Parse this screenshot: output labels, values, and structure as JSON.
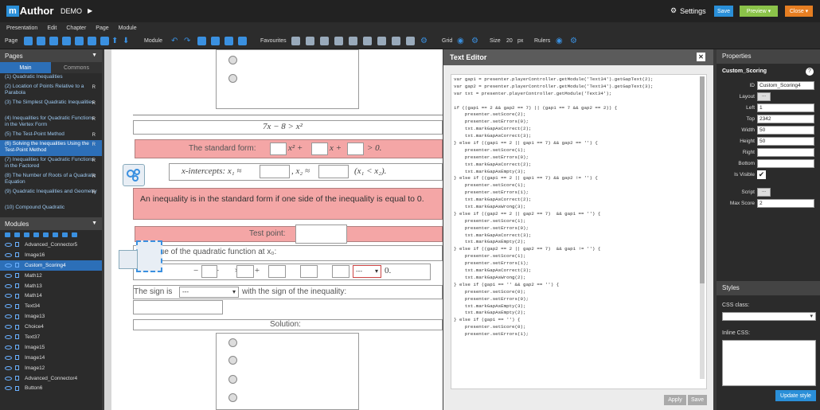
{
  "app": {
    "logo_m": "m",
    "logo_rest": "Author",
    "project": "DEMO",
    "settings": "Settings",
    "save": "Save",
    "preview": "Preview",
    "close": "Close"
  },
  "menu": [
    "Presentation",
    "Edit",
    "Chapter",
    "Page",
    "Module"
  ],
  "toolbar": {
    "page": "Page",
    "module": "Module",
    "favourites": "Favourites",
    "grid": "Grid",
    "size": "Size",
    "size_value": "20",
    "size_unit": "px",
    "rulers": "Rulers"
  },
  "pages": {
    "title": "Pages",
    "tab_main": "Main",
    "tab_commons": "Commons",
    "items": [
      {
        "label": "(1) Quadratic Inequalities",
        "r": ""
      },
      {
        "label": "(2) Location of Points Relative to a Parabola",
        "r": "R"
      },
      {
        "label": "(3) The Simplest Quadratic Inequalities",
        "r": "R"
      },
      {
        "label": "(4) Inequalities for Quadratic Functions in the Vertex Form",
        "r": "R"
      },
      {
        "label": "(5) The Test-Point Method",
        "r": "R"
      },
      {
        "label": "(6) Solving the Inequalities Using the Test-Point Method",
        "r": "R"
      },
      {
        "label": "(7) Inequalities for Quadratic Functions in the Factored",
        "r": "R"
      },
      {
        "label": "(8) The Number of Roots of a Quadratic Equation",
        "r": "R"
      },
      {
        "label": "(9) Quadratic Inequalities and Geometry",
        "r": "R"
      },
      {
        "label": "(10) Compound Quadratic",
        "r": ""
      }
    ]
  },
  "modules": {
    "title": "Modules",
    "items": [
      "Advanced_Connector5",
      "Image16",
      "Custom_Scoring4",
      "Math12",
      "Math13",
      "Math14",
      "Text34",
      "Image13",
      "Choice4",
      "Text37",
      "Image15",
      "Image14",
      "Image12",
      "Advanced_Connector4",
      "Button6"
    ]
  },
  "canvas": {
    "eq1": "7x − 8 > x²",
    "std_form": "The standard form:",
    "std_gt": "> 0.",
    "x_ints": "x-intercepts: x₁ ≈",
    "x_ints2": ", x₂ ≈",
    "x_ints3": "(x₁ < x₂).",
    "note": "An inequality is in the standard form if one side of the inequality is equal to 0.",
    "test_point": "Test point:",
    "value_of": "value of the quadratic function at x₀:",
    "select_val": "---",
    "sign_pre": "The sign is",
    "sign_post": "with the sign of the inequality:",
    "solution": "Solution:",
    "dot": "0."
  },
  "editor": {
    "title": "Text Editor",
    "apply": "Apply",
    "save": "Save",
    "code": [
      "var gap1 = presenter.playerController.getModule('Text34').getGapText(2);",
      "var gap2 = presenter.playerController.getModule('Text34').getGapText(3);",
      "var txt = presenter.playerController.getModule('Text34');",
      "",
      "if ((gap1 == 2 && gap2 == 7) || (gap1 == 7 && gap2 == 2)) {",
      "    presenter.setScore(2);",
      "    presenter.setErrors(0);",
      "    txt.markGapAsCorrect(2);",
      "    txt.markGapAsCorrect(3);",
      "} else if ((gap1 == 2 || gap1 == 7) && gap2 == '') {",
      "    presenter.setScore(1);",
      "    presenter.setErrors(0);",
      "    txt.markGapAsCorrect(2);",
      "    txt.markGapAsEmpty(3);",
      "} else if ((gap1 == 2 || gap1 == 7) && gap2 != '') {",
      "    presenter.setScore(1);",
      "    presenter.setErrors(1);",
      "    txt.markGapAsCorrect(2);",
      "    txt.markGapAsWrong(3);",
      "} else if ((gap2 == 2 || gap2 == 7)  && gap1 == '') {",
      "    presenter.setScore(1);",
      "    presenter.setErrors(0);",
      "    txt.markGapAsCorrect(3);",
      "    txt.markGapAsEmpty(2);",
      "} else if ((gap2 == 2 || gap2 == 7)  && gap1 != '') {",
      "    presenter.setScore(1);",
      "    presenter.setErrors(1);",
      "    txt.markGapAsCorrect(3);",
      "    txt.markGapAsWrong(2);",
      "} else if (gap1 == '' && gap2 == '') {",
      "    presenter.setScore(0);",
      "    presenter.setErrors(0);",
      "    txt.markGapAsEmpty(3);",
      "    txt.markGapAsEmpty(2);",
      "} else if (gap1 == '') {",
      "    presenter.setScore(0);",
      "    presenter.setErrors(1);"
    ]
  },
  "properties": {
    "title": "Properties",
    "module": "Custom_Scoring",
    "id_label": "ID",
    "id": "Custom_Scoring4",
    "layout": "Layout",
    "left": "Left",
    "left_v": "1",
    "top": "Top",
    "top_v": "2342",
    "width": "Width",
    "width_v": "50",
    "height": "Height",
    "height_v": "50",
    "right": "Right",
    "bottom": "Bottom",
    "visible": "Is Visible",
    "script": "Script",
    "max_score": "Max Score",
    "max_score_v": "2",
    "dots": "..."
  },
  "styles": {
    "title": "Styles",
    "css_class": "CSS class:",
    "inline_css": "Inline CSS:",
    "update": "Update style"
  },
  "colors": {
    "accent": "#2c6fb8",
    "save": "#2a8fd8",
    "preview": "#8bc34a",
    "close": "#e67e22"
  }
}
